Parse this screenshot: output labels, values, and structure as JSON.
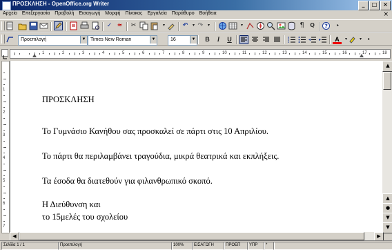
{
  "window": {
    "title": "ΠΡΟΣΚΛΗΣΗ - OpenOffice.org Writer",
    "buttons": {
      "minimize": "_",
      "maximize": "□",
      "close": "×"
    }
  },
  "menu": {
    "items": [
      "Αρχείο",
      "Επεξεργασία",
      "Προβολή",
      "Εισαγωγή",
      "Μορφή",
      "Πίνακας",
      "Εργαλεία",
      "Παράθυρο",
      "Βοήθεια"
    ],
    "doc_close": "×"
  },
  "formatting": {
    "style": "Προεπιλογή",
    "font": "Times New Roman",
    "size": "16",
    "bold": "B",
    "italic": "I",
    "underline": "U",
    "font_color_letter": "A"
  },
  "ruler": {
    "numbers": [
      "1",
      "2",
      "3",
      "4",
      "5",
      "6",
      "7",
      "8",
      "9",
      "10",
      "11",
      "12",
      "13",
      "14",
      "15",
      "16",
      "17",
      "18"
    ],
    "vnumbers": [
      "1",
      "2",
      "3",
      "4",
      "5",
      "6",
      "7"
    ]
  },
  "document": {
    "lines": [
      "ΠΡΟΣΚΛΗΣΗ",
      "Το Γυμνάσιο Κανήθου σας προσκαλεί σε πάρτι στις 10 Απριλίου.",
      "Το πάρτι θα περιλαμβάνει τραγούδια, μικρά θεατρικά και εκπλήξεις.",
      "Τα έσοδα θα διατεθούν για φιλανθρωπικό σκοπό.",
      "Η Διεύθυνση και",
      "το 15μελές του σχολείου"
    ]
  },
  "status": {
    "page": "Σελίδα 1 / 1",
    "style": "Προεπιλογή",
    "zoom": "100%",
    "insert_mode": "ΕΙΣΑΓΩΓΗ",
    "selection_mode": "ΠΡΟΕΠ",
    "hyperlink_mode": "ΥΠΡ",
    "modified": "*"
  }
}
